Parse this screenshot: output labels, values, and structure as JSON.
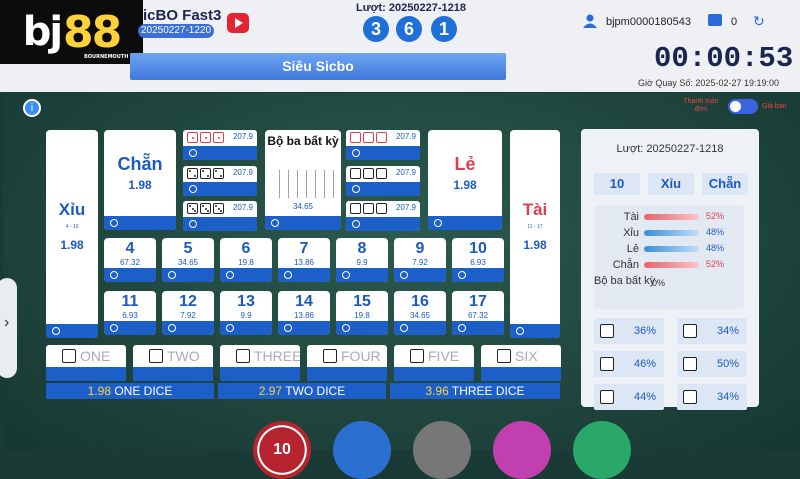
{
  "header": {
    "logo": "bj88",
    "logo_sub": "BOURNEMOUTH",
    "game_title": "icBO Fast3",
    "game_id": "20250227-1220",
    "round_label": "Lượt: 20250227-1218",
    "balls": [
      "3",
      "6",
      "1"
    ],
    "username": "bjpm0000180543",
    "balance": "0",
    "tab": "Siêu Sicbo",
    "timer": "00:00:53",
    "draw_time": "Giờ Quay Số: 2025-02-27 19:19:00"
  },
  "controls": {
    "toggle_left": "Thanh toán đơn",
    "toggle_right": "Giá bán"
  },
  "bets": {
    "xiu": {
      "label": "Xỉu",
      "range": "4 - 10",
      "odd": "1.98"
    },
    "chan": {
      "label": "Chẵn",
      "odd": "1.98"
    },
    "triples_left": [
      "207.9",
      "207.9",
      "207.9"
    ],
    "any_triple": {
      "label": "Bộ ba bất kỳ",
      "odd": "34.65"
    },
    "triples_right": [
      "207.9",
      "207.9",
      "207.9"
    ],
    "le": {
      "label": "Lẻ",
      "odd": "1.98"
    },
    "tai": {
      "label": "Tài",
      "range": "11 - 17",
      "odd": "1.98"
    },
    "totals_row1": [
      {
        "n": "4",
        "o": "67.32"
      },
      {
        "n": "5",
        "o": "34.65"
      },
      {
        "n": "6",
        "o": "19.8"
      },
      {
        "n": "7",
        "o": "13.86"
      },
      {
        "n": "8",
        "o": "9.9"
      },
      {
        "n": "9",
        "o": "7.92"
      },
      {
        "n": "10",
        "o": "6.93"
      }
    ],
    "totals_row2": [
      {
        "n": "11",
        "o": "6.93"
      },
      {
        "n": "12",
        "o": "7.92"
      },
      {
        "n": "13",
        "o": "9.9"
      },
      {
        "n": "14",
        "o": "13.86"
      },
      {
        "n": "15",
        "o": "19.8"
      },
      {
        "n": "16",
        "o": "34.65"
      },
      {
        "n": "17",
        "o": "67.32"
      }
    ],
    "singles": [
      "ONE",
      "TWO",
      "THREE",
      "FOUR",
      "FIVE",
      "SIX"
    ],
    "multipliers": [
      {
        "v": "1.98",
        "t": "ONE DICE"
      },
      {
        "v": "2.97",
        "t": "TWO DICE"
      },
      {
        "v": "3.96",
        "t": "THREE DICE"
      }
    ]
  },
  "panel": {
    "title": "Lượt: 20250227-1218",
    "stats": [
      "10",
      "Xỉu",
      "Chẵn"
    ],
    "bars": [
      {
        "n": "Tài",
        "p": "52%",
        "c": "#e8616b"
      },
      {
        "n": "Xỉu",
        "p": "48%",
        "c": "#3a8ed8"
      },
      {
        "n": "Lẻ",
        "p": "48%",
        "c": "#3a8ed8"
      },
      {
        "n": "Chẵn",
        "p": "52%",
        "c": "#e8616b"
      }
    ],
    "any_triple_label": "Bộ ba bất kỳ",
    "any_triple_pct": "0%",
    "dice_pct": [
      "36%",
      "34%",
      "46%",
      "50%",
      "44%",
      "34%"
    ]
  },
  "chips": [
    "10"
  ]
}
